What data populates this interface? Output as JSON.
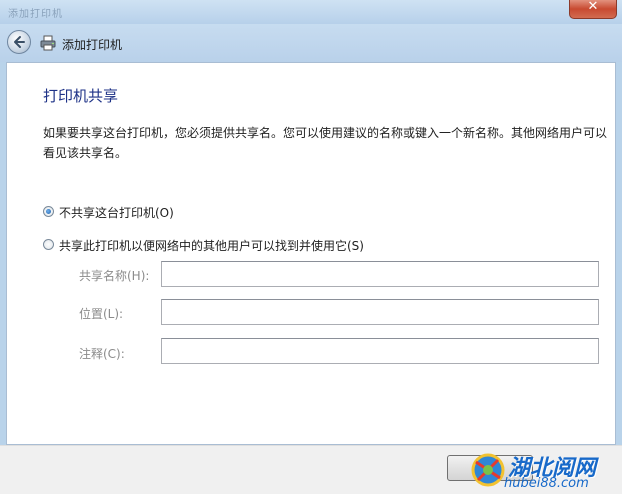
{
  "window": {
    "title": "添加打印机",
    "close_glyph": "✕"
  },
  "nav": {
    "title": "添加打印机",
    "back_icon": "back-arrow-icon",
    "printer_icon": "printer-icon"
  },
  "page": {
    "heading": "打印机共享",
    "description": "如果要共享这台打印机，您必须提供共享名。您可以使用建议的名称或键入一个新名称。其他网络用户可以看见该共享名。"
  },
  "options": [
    {
      "label": "不共享这台打印机(O)",
      "checked": true
    },
    {
      "label": "共享此打印机以便网络中的其他用户可以找到并使用它(S)",
      "checked": false
    }
  ],
  "fields": [
    {
      "label": "共享名称(H):",
      "value": ""
    },
    {
      "label": "位置(L):",
      "value": ""
    },
    {
      "label": "注释(C):",
      "value": ""
    }
  ],
  "watermark": {
    "brand": "湖北阅网",
    "url": "hubei88.com"
  }
}
